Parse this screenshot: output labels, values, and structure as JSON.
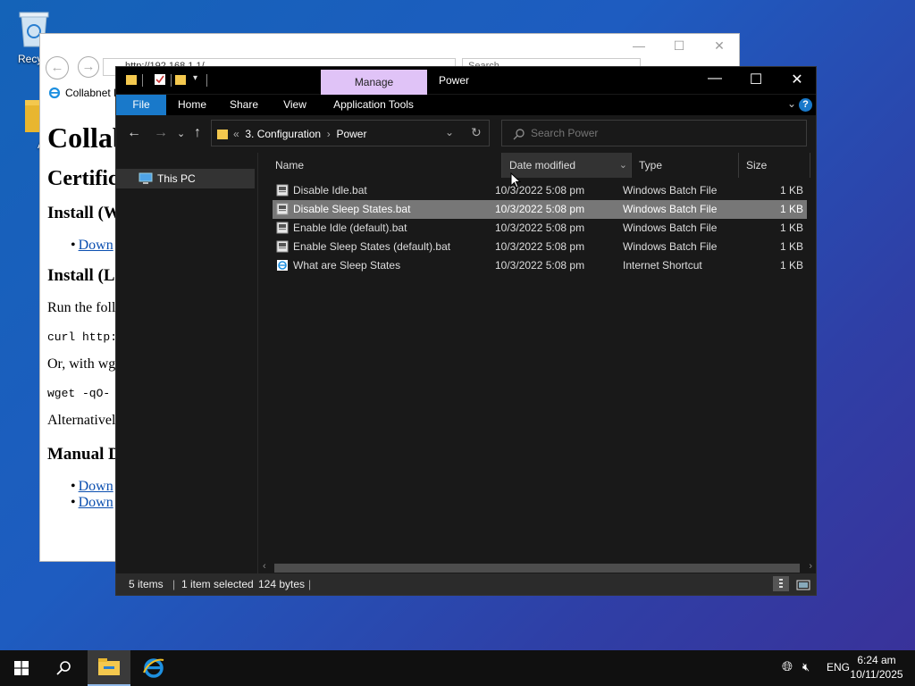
{
  "desktop": {
    "icons": [
      {
        "label": "Recycl",
        "icon": "recycle-bin-icon"
      },
      {
        "label": "Ati",
        "icon": "folder-icon"
      }
    ]
  },
  "ie": {
    "address": "http://192.168.1.1/",
    "search_placeholder": "Search...",
    "tab_title": "Collabnet R",
    "page": {
      "h1": "Collab",
      "h2": "Certific",
      "install_win": "Install (W",
      "download_1": "Down",
      "install_linux": "Install (Li",
      "run_text": "Run the foll",
      "curl_text": "curl http:",
      "or_text": "Or, with wg",
      "wget_text": "wget -qO-",
      "alt_text": "Alternativel",
      "manual_heading": "Manual D",
      "download_2": "Down",
      "download_3": "Down"
    }
  },
  "explorer": {
    "window_title": "Power",
    "manage_tab": "Manage",
    "ribbon_tabs": [
      "File",
      "Home",
      "Share",
      "View",
      "Application Tools"
    ],
    "breadcrumb": [
      "3. Configuration",
      "Power"
    ],
    "breadcrumb_sep": "›",
    "breadcrumb_prefix": "«",
    "search_placeholder": "Search Power",
    "nav_items": [
      {
        "label": "This PC",
        "icon": "this-pc-icon"
      }
    ],
    "columns": [
      "Name",
      "Date modified",
      "Type",
      "Size"
    ],
    "files": [
      {
        "name": "Disable Idle.bat",
        "date": "10/3/2022 5:08 pm",
        "type": "Windows Batch File",
        "size": "1 KB",
        "icon": "batch-file-icon",
        "selected": false
      },
      {
        "name": "Disable Sleep States.bat",
        "date": "10/3/2022 5:08 pm",
        "type": "Windows Batch File",
        "size": "1 KB",
        "icon": "batch-file-icon",
        "selected": true
      },
      {
        "name": "Enable Idle (default).bat",
        "date": "10/3/2022 5:08 pm",
        "type": "Windows Batch File",
        "size": "1 KB",
        "icon": "batch-file-icon",
        "selected": false
      },
      {
        "name": "Enable Sleep States (default).bat",
        "date": "10/3/2022 5:08 pm",
        "type": "Windows Batch File",
        "size": "1 KB",
        "icon": "batch-file-icon",
        "selected": false
      },
      {
        "name": "What are Sleep States",
        "date": "10/3/2022 5:08 pm",
        "type": "Internet Shortcut",
        "size": "1 KB",
        "icon": "internet-shortcut-icon",
        "selected": false
      }
    ],
    "status": {
      "items": "5 items",
      "selected": "1 item selected",
      "bytes": "124 bytes"
    },
    "colors": {
      "accent": "#1979ca",
      "manage": "#e0c3f7",
      "selected_row": "#777777"
    }
  },
  "taskbar": {
    "lang": "ENG",
    "time": "6:24 am",
    "date": "10/11/2025"
  }
}
